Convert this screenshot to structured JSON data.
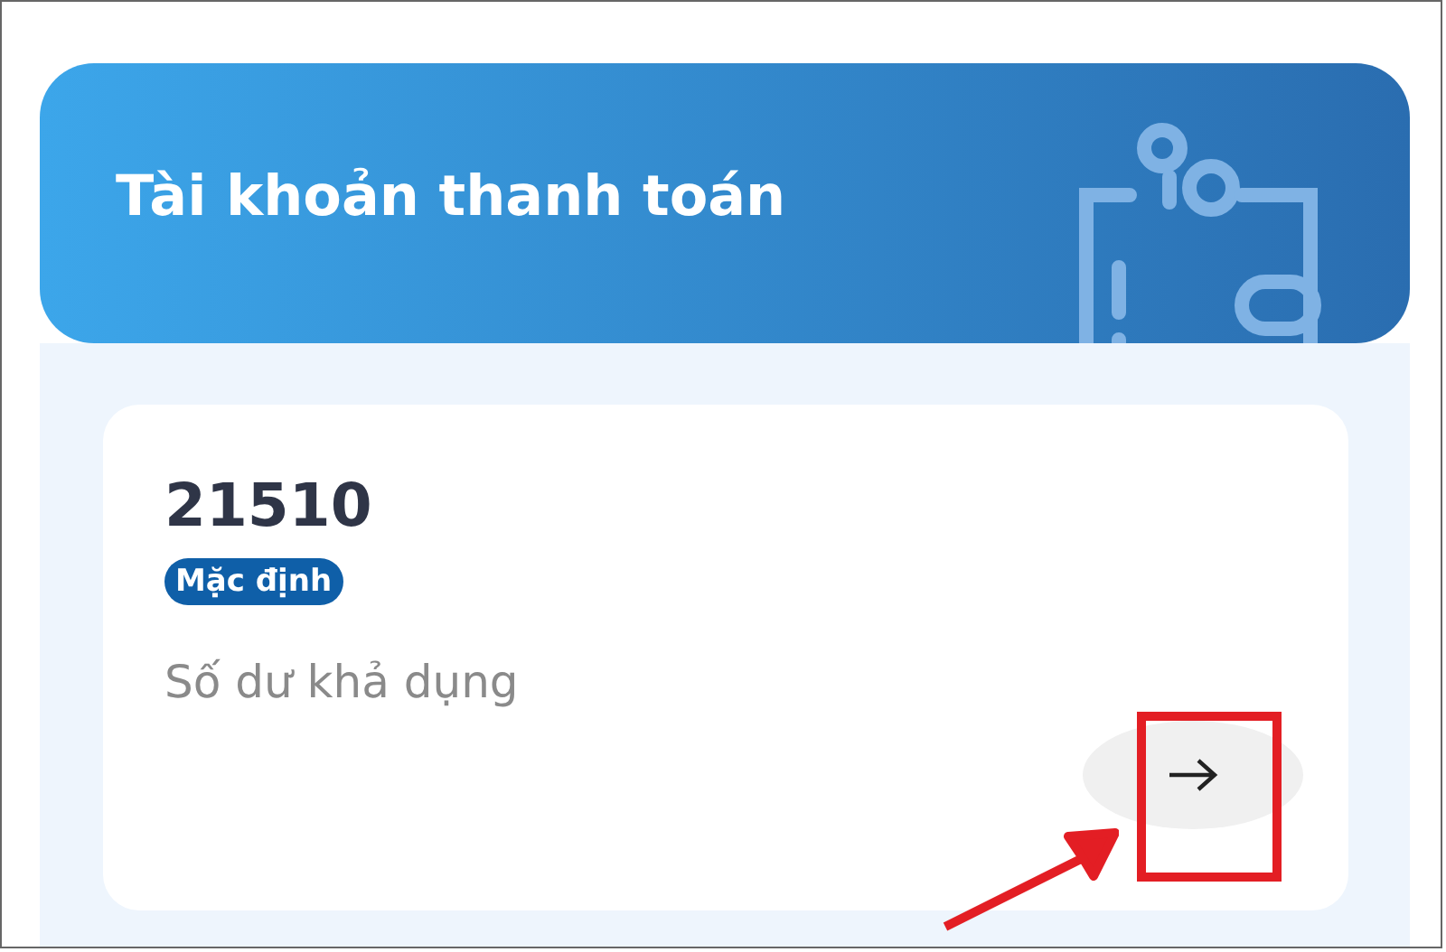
{
  "header": {
    "title": "Tài khoản thanh toán"
  },
  "account": {
    "number": "21510",
    "badge": "Mặc định",
    "balance_label": "Số dư khả dụng"
  }
}
